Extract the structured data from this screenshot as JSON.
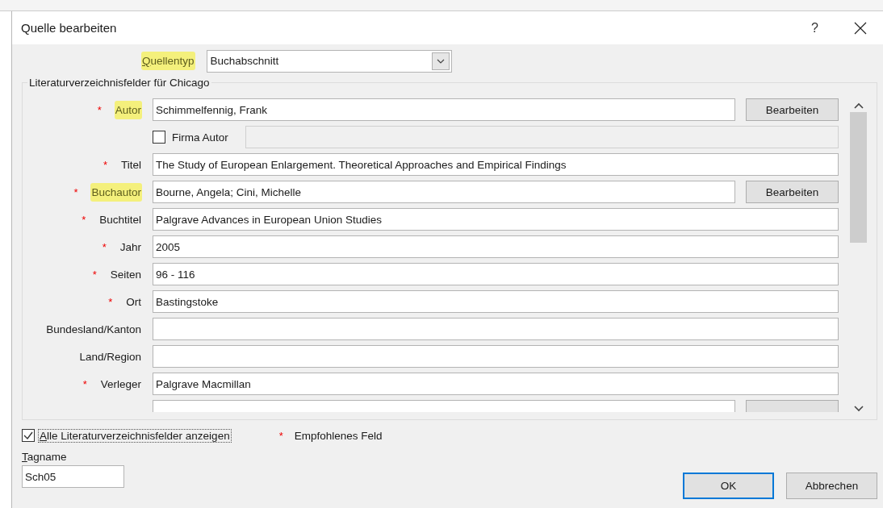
{
  "window": {
    "title": "Quelle bearbeiten",
    "help": "?"
  },
  "source_type": {
    "label": "Quellentyp",
    "highlighted": true,
    "access_key_first": true,
    "value": "Buchabschnitt"
  },
  "group": {
    "legend": "Literaturverzeichnisfelder für Chicago"
  },
  "fields": [
    {
      "kind": "field_button",
      "label": "Autor",
      "marker": "*",
      "highlighted": true,
      "value": "Schimmelfennig, Frank",
      "button": "Bearbeiten"
    },
    {
      "kind": "checkbox",
      "label": "Firma Autor",
      "checked": false
    },
    {
      "kind": "field",
      "label": "Titel",
      "marker": "*",
      "highlighted": false,
      "value": "The Study of European Enlargement. Theoretical Approaches and Empirical Findings"
    },
    {
      "kind": "field_button",
      "label": "Buchautor",
      "marker": "*",
      "highlighted": true,
      "value": "Bourne, Angela; Cini, Michelle",
      "button": "Bearbeiten"
    },
    {
      "kind": "field",
      "label": "Buchtitel",
      "marker": "*",
      "highlighted": false,
      "value": "Palgrave Advances in European Union Studies"
    },
    {
      "kind": "field",
      "label": "Jahr",
      "marker": "*",
      "highlighted": false,
      "value": "2005"
    },
    {
      "kind": "field",
      "label": "Seiten",
      "marker": "*",
      "highlighted": false,
      "value": "96 - 116"
    },
    {
      "kind": "field",
      "label": "Ort",
      "marker": "*",
      "highlighted": false,
      "value": "Bastingstoke"
    },
    {
      "kind": "field",
      "label": "Bundesland/Kanton",
      "highlighted": false
    },
    {
      "kind": "field",
      "label": "Land/Region",
      "highlighted": false
    },
    {
      "kind": "field",
      "label": "Verleger",
      "marker": "*",
      "highlighted": false,
      "value": "Palgrave Macmillan"
    },
    {
      "kind": "cut_field_button"
    }
  ],
  "show_all": {
    "label": "Alle Literaturverzeichnisfelder anzeigen",
    "checked": true,
    "access_key_first": true
  },
  "legend": {
    "marker": "*",
    "text": "Empfohlenes Feld"
  },
  "tag": {
    "label": "Tagname",
    "access_key_first": true,
    "value": "Sch05"
  },
  "buttons": [
    {
      "label": "OK",
      "default": true
    },
    {
      "label": "Abbrechen",
      "default": false
    }
  ]
}
